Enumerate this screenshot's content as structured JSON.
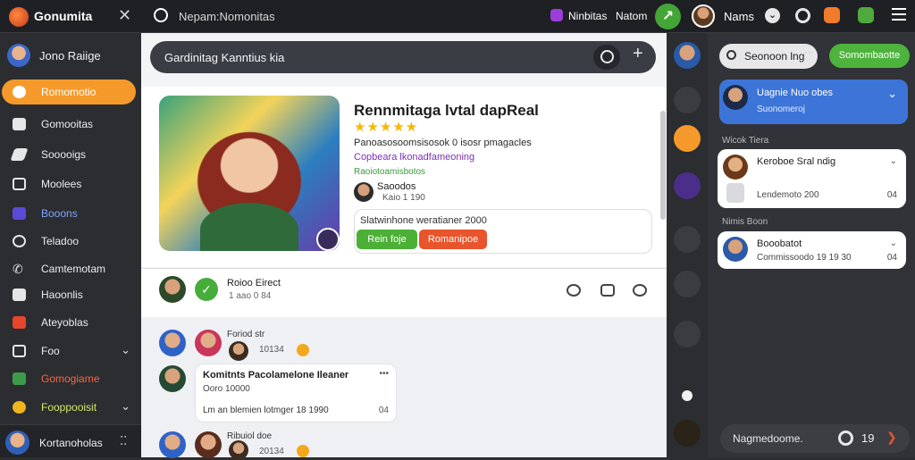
{
  "topbar": {
    "app_title": "Gonumita",
    "breadcrumb": "Nepam:Nomonitas",
    "link_1": "Ninbitas",
    "link_2": "Natom",
    "user_name": "Nams"
  },
  "sidebar": {
    "user_name": "Jono Raiige",
    "items": [
      {
        "label": "Romomotio",
        "active": true
      },
      {
        "label": "Gomooitas"
      },
      {
        "label": "Sooooigs"
      },
      {
        "label": "Moolees"
      },
      {
        "label": "Booons"
      },
      {
        "label": "Teladoo"
      },
      {
        "label": "Camtemotam"
      },
      {
        "label": "Haoonlis"
      },
      {
        "label": "Ateyoblas"
      },
      {
        "label": "Foo"
      },
      {
        "label": "Gomogiame"
      },
      {
        "label": "Fooppooisit"
      }
    ],
    "footer_name": "Kortanoholas",
    "footer_dots": "⁚⁚"
  },
  "main": {
    "search_text": "Gardinitag Kanntius kia",
    "card": {
      "title": "Rennmitaga lvtal dapReal",
      "stars": "★★★★★",
      "description": "Panoasosoomsisosok 0 isosr pmagacles",
      "link": "Copbeara lkonadfameoning",
      "tag": "Raoiotoamisbotos",
      "creator_name": "Saoodos",
      "creator_meta": "Kaio 1 190",
      "info_text": "Slatwinhone weratianer 2000",
      "btn_primary": "Rein foje",
      "btn_secondary": "Romanipoe"
    },
    "post": {
      "title": "Roioo Eirect",
      "meta": "1 aao 0 84"
    },
    "thread": {
      "name_1": "Foriod str",
      "time_1": "10134",
      "bubble_title": "Komitnts Pacolamelone Ileaner",
      "bubble_sub": "Ooro 10000",
      "bubble_body": "Lm an blemien lotmger 18 1990",
      "bubble_time": "04",
      "name_2": "Ribuiol doe",
      "time_2": "20134"
    }
  },
  "rpanel": {
    "search_text": "Seonoon lng",
    "search_dots": "•••",
    "green_button": "Somombaotte",
    "blue_card_title": "Uagnie Nuo obes",
    "blue_card_sub": "Suonomeroj",
    "section_1": "Wicok Tiera",
    "card_1_title": "Keroboe Sral ndig",
    "card_1_sub": "Lendemoto 200",
    "card_1_meta": "04",
    "section_2": "Nimis Boon",
    "card_2_title": "Booobatot",
    "card_2_sub": "Commissoodo 19 19 30",
    "card_2_meta": "04",
    "bottom_text": "Nagmedoome.",
    "bottom_num": "19"
  }
}
